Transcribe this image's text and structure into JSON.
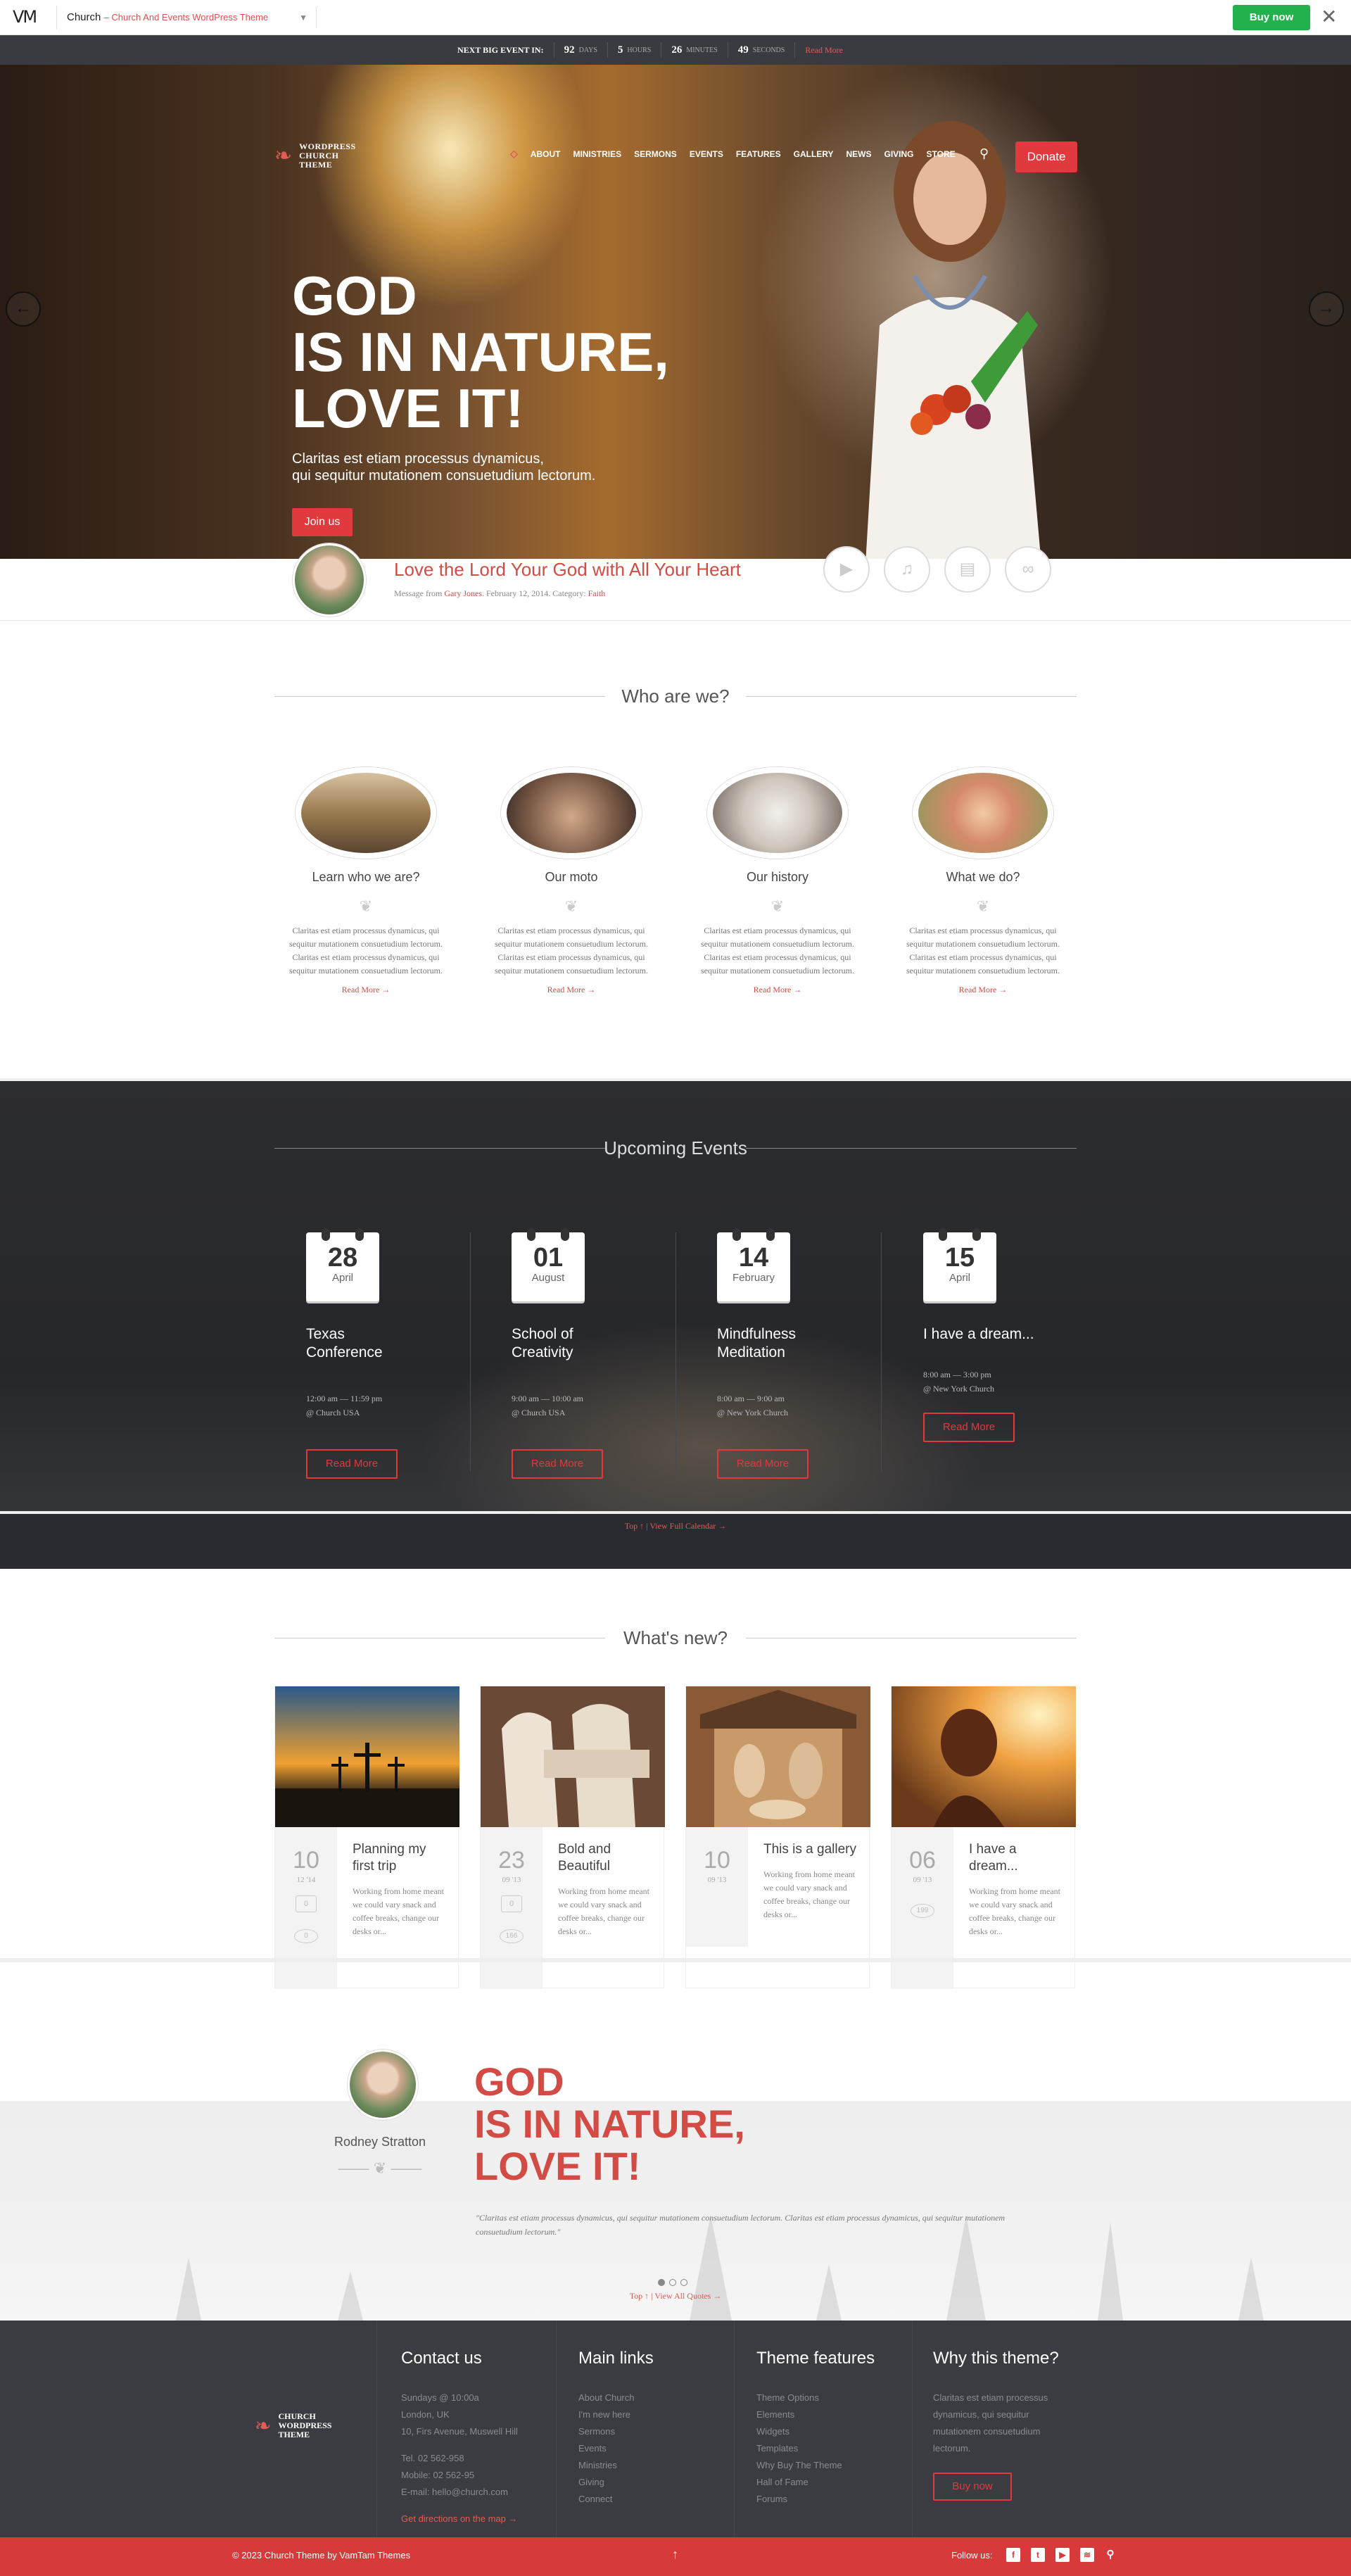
{
  "topbar": {
    "logo": "VM",
    "product_name": "Church",
    "product_sub": "– Church And Events WordPress Theme",
    "buy_label": "Buy now",
    "close_icon": "close-icon",
    "buy_color": "#22b14c"
  },
  "countdown": {
    "label": "NEXT BIG EVENT IN:",
    "days": "92",
    "days_unit": "DAYS",
    "hours": "5",
    "hours_unit": "HOURS",
    "minutes": "26",
    "minutes_unit": "MINUTES",
    "seconds": "49",
    "seconds_unit": "SECONDS",
    "read_more": "Read More"
  },
  "site": {
    "logo_line1": "WORDPRESS",
    "logo_line2": "CHURCH",
    "logo_line3": "THEME",
    "accent_color": "#e0393e"
  },
  "nav": {
    "items": [
      "ABOUT",
      "MINISTRIES",
      "SERMONS",
      "EVENTS",
      "FEATURES",
      "GALLERY",
      "NEWS",
      "GIVING",
      "STORE"
    ],
    "donate": "Donate"
  },
  "hero": {
    "title_line1": "GOD",
    "title_line2": "IS IN NATURE,",
    "title_line3": "LOVE IT!",
    "sub_line1": "Claritas est etiam processus dynamicus,",
    "sub_line2": "qui sequitur mutationem consuetudium lectorum.",
    "cta": "Join us"
  },
  "sermon": {
    "title": "Love the Lord Your God with All Your Heart",
    "meta_prefix": "Message from",
    "author": "Gary Jones",
    "meta_date": ". February 12, 2014. Category:",
    "category": "Faith"
  },
  "who": {
    "heading": "Who are we?",
    "items": [
      {
        "title": "Learn who we are?",
        "text": "Claritas est etiam processus dynamicus, qui sequitur mutationem consuetudium lectorum. Claritas est etiam processus dynamicus, qui sequitur mutationem consuetudium lectorum.",
        "more": "Read More →"
      },
      {
        "title": "Our moto",
        "text": "Claritas est etiam processus dynamicus, qui sequitur mutationem consuetudium lectorum. Claritas est etiam processus dynamicus, qui sequitur mutationem consuetudium lectorum.",
        "more": "Read More →"
      },
      {
        "title": "Our history",
        "text": "Claritas est etiam processus dynamicus, qui sequitur mutationem consuetudium lectorum. Claritas est etiam processus dynamicus, qui sequitur mutationem consuetudium lectorum.",
        "more": "Read More →"
      },
      {
        "title": "What we do?",
        "text": "Claritas est etiam processus dynamicus, qui sequitur mutationem consuetudium lectorum. Claritas est etiam processus dynamicus, qui sequitur mutationem consuetudium lectorum.",
        "more": "Read More →"
      }
    ]
  },
  "events": {
    "heading": "Upcoming Events",
    "items": [
      {
        "day": "28",
        "month": "April",
        "title1": "Texas",
        "title2": "Conference",
        "time": "12:00 am — 11:59 pm",
        "place": "@ Church USA",
        "btn": "Read More"
      },
      {
        "day": "01",
        "month": "August",
        "title1": "School of",
        "title2": "Creativity",
        "time": "9:00 am — 10:00 am",
        "place": "@ Church USA",
        "btn": "Read More"
      },
      {
        "day": "14",
        "month": "February",
        "title1": "Mindfulness",
        "title2": "Meditation",
        "time": "8:00 am — 9:00 am",
        "place": "@ New York Church",
        "btn": "Read More"
      },
      {
        "day": "15",
        "month": "April",
        "title1": "I have a dream...",
        "title2": "",
        "time": "8:00 am — 3:00 pm",
        "place": "@ New York Church",
        "btn": "Read More"
      }
    ],
    "links": "Top ↑ | View Full Calendar →"
  },
  "news": {
    "heading": "What's new?",
    "items": [
      {
        "day": "10",
        "month": "12 '14",
        "title": "Planning my first trip",
        "text": "Working from home meant we could vary snack and coffee breaks, change our desks or...",
        "comments": "0",
        "likes": "0"
      },
      {
        "day": "23",
        "month": "09 '13",
        "title": "Bold and Beautiful",
        "text": "Working from home meant we could vary snack and coffee breaks, change our desks or...",
        "comments": "0",
        "likes": "166"
      },
      {
        "day": "10",
        "month": "09 '13",
        "title": "This is a gallery",
        "text": "Working from home meant we could vary snack and coffee breaks, change our desks or...",
        "comments": "",
        "likes": ""
      },
      {
        "day": "06",
        "month": "09 '13",
        "title": "I have a dream...",
        "text": "Working from home meant we could vary snack and coffee breaks, change our desks or...",
        "comments": "",
        "likes": "199"
      }
    ]
  },
  "testimonial": {
    "name": "Rodney Stratton",
    "title_line1": "GOD",
    "title_line2": "IS IN NATURE,",
    "title_line3": "LOVE IT!",
    "quote": "\"Claritas est etiam processus dynamicus, qui sequitur mutationem consuetudium lectorum. Claritas est etiam processus dynamicus, qui sequitur mutationem consuetudium lectorum.\"",
    "links": "Top ↑ | View All Quotes →"
  },
  "footer": {
    "logo_line1": "CHURCH",
    "logo_line2": "WORDPRESS",
    "logo_line3": "THEME",
    "contact": {
      "heading": "Contact us",
      "lines": [
        "Sundays @ 10:00a",
        "London, UK",
        "10, Firs Avenue, Muswell Hill"
      ],
      "tel": "Tel. 02 562-958",
      "mobile": "Mobile: 02 562-95",
      "email": "E-mail: hello@church.com",
      "directions": "Get directions on the map →"
    },
    "main_links": {
      "heading": "Main links",
      "items": [
        "About Church",
        "I'm new here",
        "Sermons",
        "Events",
        "Ministries",
        "Giving",
        "Connect"
      ]
    },
    "theme_features": {
      "heading": "Theme features",
      "items": [
        "Theme Options",
        "Elements",
        "Widgets",
        "Templates",
        "Why Buy The Theme",
        "Hall of Fame",
        "Forums"
      ]
    },
    "why": {
      "heading": "Why this theme?",
      "text": "Claritas est etiam processus dynamicus, qui sequitur mutationem consuetudium lectorum.",
      "btn": "Buy now"
    },
    "copyright": "© 2023 Church Theme by VamTam Themes",
    "to_top": "↑",
    "follow": "Follow us:",
    "social": [
      "facebook-icon",
      "twitter-icon",
      "youtube-icon",
      "rss-icon",
      "search-icon"
    ]
  }
}
